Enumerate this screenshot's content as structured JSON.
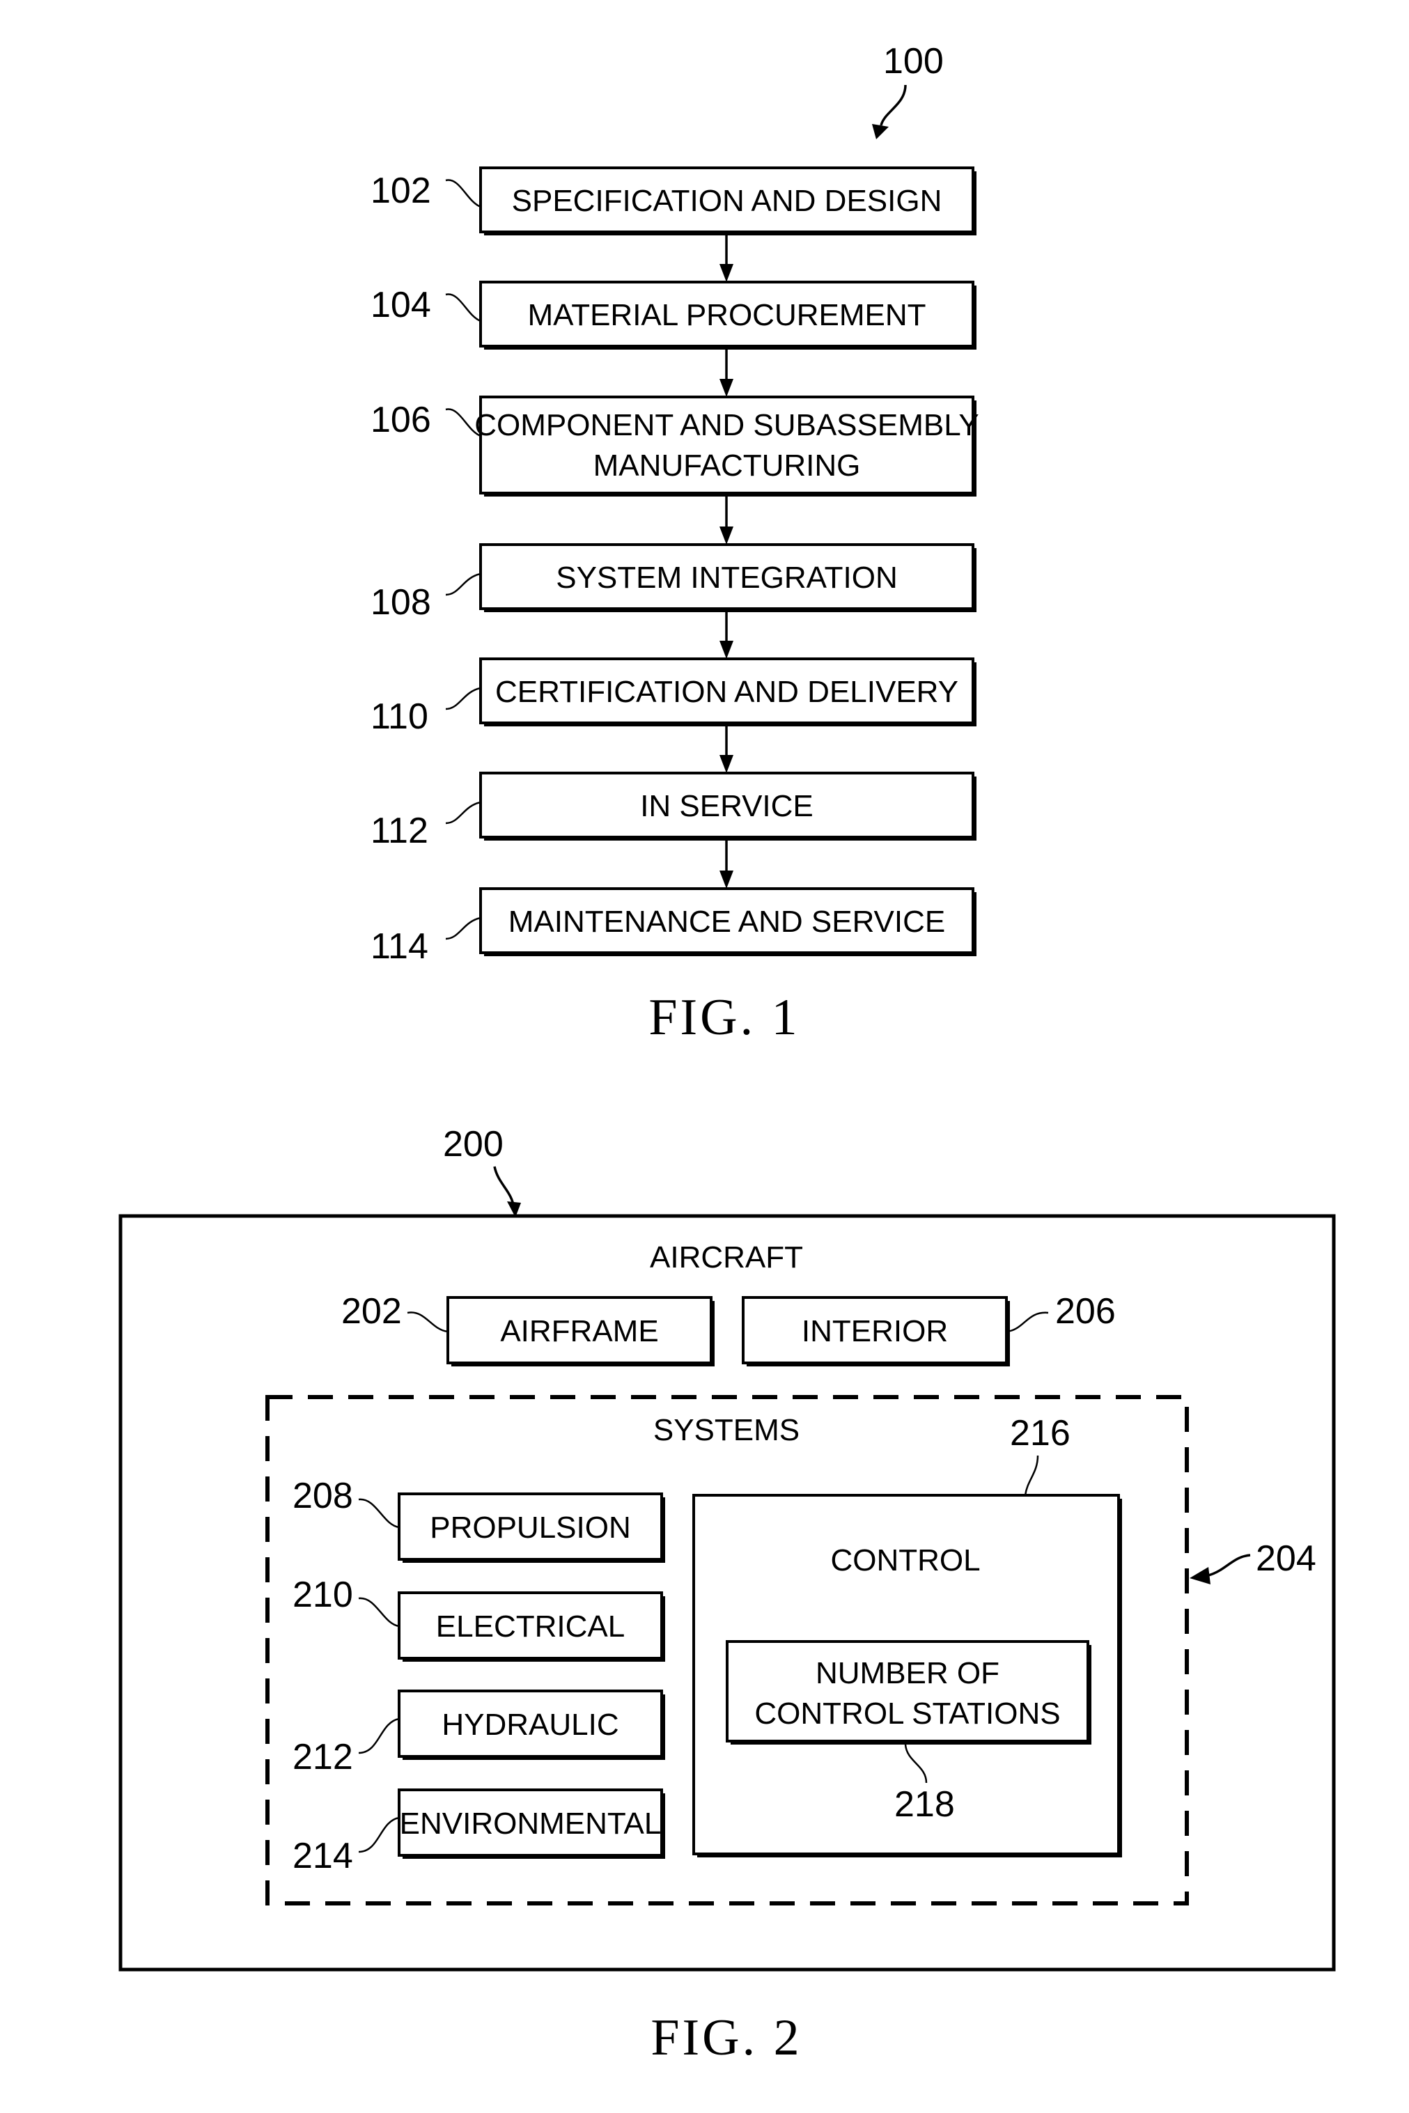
{
  "figure1": {
    "caption": "FIG. 1",
    "ref": "100",
    "steps": [
      {
        "ref": "102",
        "lines": [
          "SPECIFICATION AND DESIGN"
        ]
      },
      {
        "ref": "104",
        "lines": [
          "MATERIAL PROCUREMENT"
        ]
      },
      {
        "ref": "106",
        "lines": [
          "COMPONENT AND SUBASSEMBLY",
          "MANUFACTURING"
        ]
      },
      {
        "ref": "108",
        "lines": [
          "SYSTEM INTEGRATION"
        ]
      },
      {
        "ref": "110",
        "lines": [
          "CERTIFICATION AND DELIVERY"
        ]
      },
      {
        "ref": "112",
        "lines": [
          "IN SERVICE"
        ]
      },
      {
        "ref": "114",
        "lines": [
          "MAINTENANCE AND SERVICE"
        ]
      }
    ]
  },
  "figure2": {
    "caption": "FIG. 2",
    "ref": "200",
    "aircraft": {
      "label": "AIRCRAFT"
    },
    "airframe": {
      "ref": "202",
      "label": "AIRFRAME"
    },
    "interior": {
      "ref": "206",
      "label": "INTERIOR"
    },
    "systems": {
      "ref": "204",
      "label": "SYSTEMS",
      "items": [
        {
          "ref": "208",
          "label": "PROPULSION"
        },
        {
          "ref": "210",
          "label": "ELECTRICAL"
        },
        {
          "ref": "212",
          "label": "HYDRAULIC"
        },
        {
          "ref": "214",
          "label": "ENVIRONMENTAL"
        }
      ],
      "control": {
        "ref": "216",
        "label": "CONTROL",
        "stations": {
          "ref": "218",
          "lines": [
            "NUMBER OF",
            "CONTROL STATIONS"
          ]
        }
      }
    }
  }
}
